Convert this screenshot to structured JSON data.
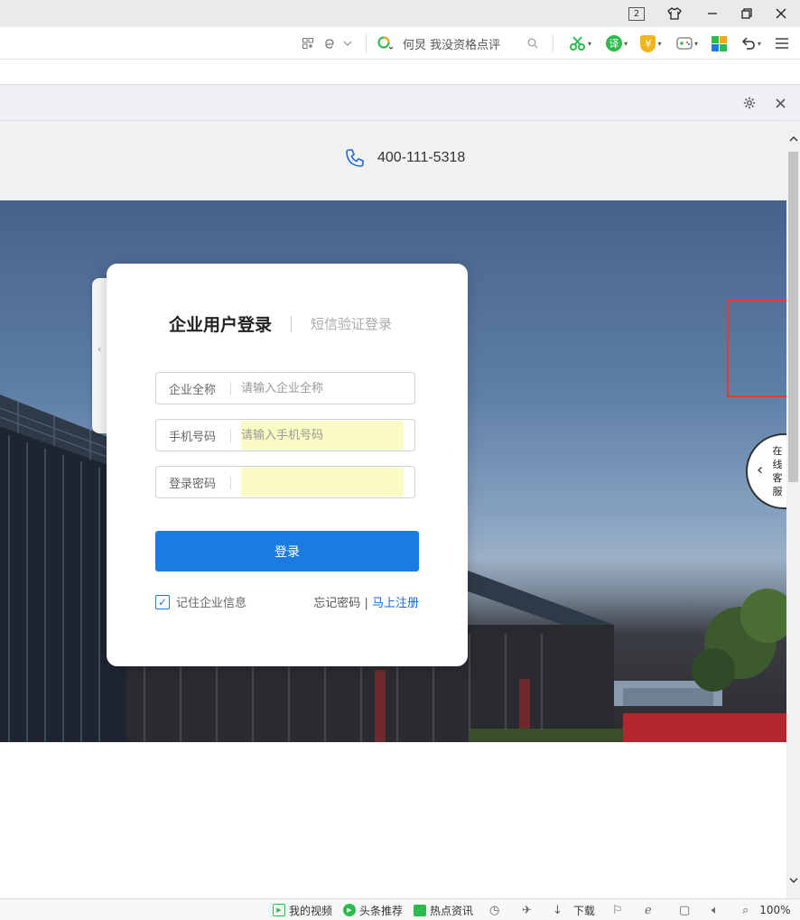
{
  "titlebar": {
    "tab_count": "2"
  },
  "toolbar": {
    "search_prefix": "何炅",
    "search_text": "我没资格点评",
    "translate_badge": "译",
    "shield_badge": "¥"
  },
  "page": {
    "phone": "400-111-5318",
    "login": {
      "tab_active": "企业用户登录",
      "tab_inactive": "短信验证登录",
      "company_label": "企业全称",
      "company_placeholder": "请输入企业全称",
      "phone_label": "手机号码",
      "phone_placeholder": "请输入手机号码",
      "password_label": "登录密码",
      "password_value": "",
      "submit_label": "登录",
      "remember_label": "记住企业信息",
      "remember_checked": true,
      "forgot_label": "忘记密码",
      "link_sep": "|",
      "register_label": "马上注册"
    },
    "customer_service": {
      "chars": [
        "在",
        "线",
        "客",
        "服"
      ]
    }
  },
  "statusbar": {
    "video": "我的视频",
    "headlines": "头条推荐",
    "hotnews": "热点资讯",
    "download": "下载",
    "zoom": "100%"
  },
  "colors": {
    "accent": "#1a7be0",
    "highlight_border": "#e53935",
    "brand_green": "#2dbb4e"
  }
}
